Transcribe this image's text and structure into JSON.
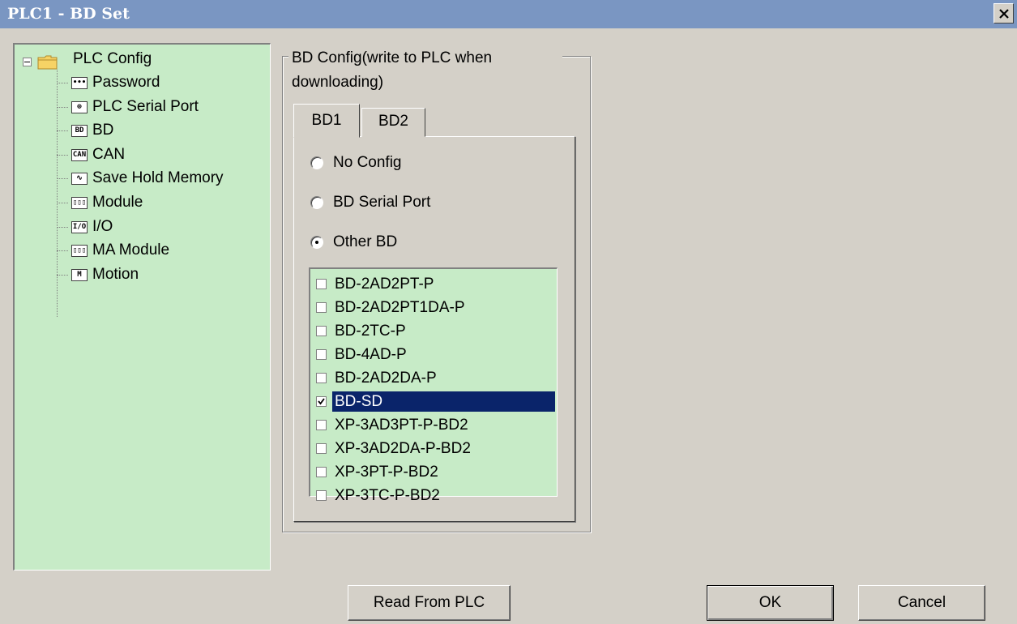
{
  "window": {
    "title": "PLC1 - BD  Set",
    "close_symbol": "×"
  },
  "tree": {
    "root": {
      "label": "PLC Config",
      "icon": "folder-icon"
    },
    "items": [
      {
        "label": "Password",
        "icon": "password-icon",
        "glyph": "•••"
      },
      {
        "label": "PLC Serial Port",
        "icon": "serial-port-icon",
        "glyph": "⊕"
      },
      {
        "label": "BD",
        "icon": "bd-icon",
        "glyph": "BD"
      },
      {
        "label": "CAN",
        "icon": "can-icon",
        "glyph": "CAN"
      },
      {
        "label": "Save Hold Memory",
        "icon": "memory-icon",
        "glyph": "∿"
      },
      {
        "label": "Module",
        "icon": "module-icon",
        "glyph": "▯▯▯"
      },
      {
        "label": "I/O",
        "icon": "io-icon",
        "glyph": "I/O"
      },
      {
        "label": "MA Module",
        "icon": "ma-module-icon",
        "glyph": "▯▯▯"
      },
      {
        "label": "Motion",
        "icon": "motion-icon",
        "glyph": "M"
      }
    ],
    "selected": "BD"
  },
  "group": {
    "caption_line1": "BD Config(write to PLC when",
    "caption_line2": "downloading)"
  },
  "tabs": [
    {
      "label": "BD1",
      "active": true
    },
    {
      "label": "BD2",
      "active": false
    }
  ],
  "radios": [
    {
      "label": "No Config",
      "checked": false
    },
    {
      "label": "BD Serial Port",
      "checked": false
    },
    {
      "label": "Other BD",
      "checked": true
    }
  ],
  "bd_list": [
    {
      "label": "BD-2AD2PT-P",
      "checked": false
    },
    {
      "label": "BD-2AD2PT1DA-P",
      "checked": false
    },
    {
      "label": "BD-2TC-P",
      "checked": false
    },
    {
      "label": "BD-4AD-P",
      "checked": false
    },
    {
      "label": "BD-2AD2DA-P",
      "checked": false
    },
    {
      "label": "BD-SD",
      "checked": true,
      "selected": true
    },
    {
      "label": "XP-3AD3PT-P-BD2",
      "checked": false
    },
    {
      "label": "XP-3AD2DA-P-BD2",
      "checked": false
    },
    {
      "label": "XP-3PT-P-BD2",
      "checked": false
    },
    {
      "label": "XP-3TC-P-BD2",
      "checked": false
    }
  ],
  "buttons": {
    "read": "Read From PLC",
    "ok": "OK",
    "cancel": "Cancel"
  },
  "colors": {
    "titlebar": "#7a96c2",
    "panel_bg": "#c7ebc7",
    "dialog_bg": "#d4d0c8",
    "selection": "#0a246a"
  }
}
